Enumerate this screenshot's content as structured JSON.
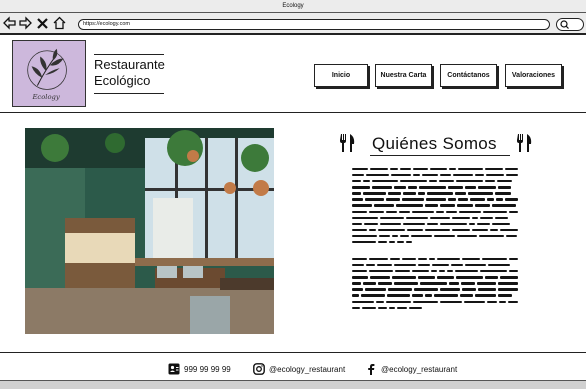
{
  "browser": {
    "title": "Ecology",
    "url": "https://ecology.com"
  },
  "header": {
    "logo_text": "Ecology",
    "brand_line1": "Restaurante",
    "brand_line2": "Ecológico",
    "nav": [
      {
        "label": "Inicio"
      },
      {
        "label": "Nuestra Carta"
      },
      {
        "label": "Contáctanos"
      },
      {
        "label": "Valoraciones"
      }
    ]
  },
  "main": {
    "section_title": "Quiénes Somos",
    "photo": "restaurant-interior-photo"
  },
  "footer": {
    "phone": "999 99 99 99",
    "instagram": "@ecology_restaurant",
    "facebook": "@ecology_restaurant"
  },
  "colors": {
    "logo_bg": "#cdb8dc",
    "ink": "#111111"
  }
}
